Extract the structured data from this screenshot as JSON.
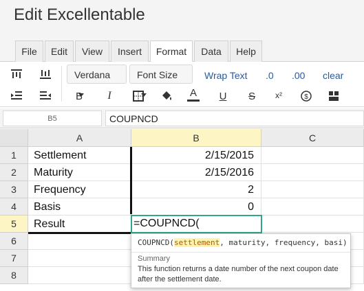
{
  "app": {
    "title": "Edit Excellentable"
  },
  "menu": {
    "tabs": [
      {
        "label": "File"
      },
      {
        "label": "Edit"
      },
      {
        "label": "View"
      },
      {
        "label": "Insert"
      },
      {
        "label": "Format",
        "active": true
      },
      {
        "label": "Data"
      },
      {
        "label": "Help"
      }
    ]
  },
  "toolbar": {
    "font_family": "Verdana",
    "font_size": "Font Size",
    "wrap_text": "Wrap Text",
    "decrease_decimal": ".0",
    "increase_decimal": ".00",
    "clear": "clear",
    "bold": "B",
    "italic": "I",
    "font_color": "A",
    "underline": "U",
    "strikethrough": "S",
    "superscript": "x²"
  },
  "formula_bar": {
    "cell_ref": "B5",
    "formula": "COUPNCD"
  },
  "sheet": {
    "columns": [
      "A",
      "B",
      "C"
    ],
    "rows": [
      {
        "num": "1",
        "a": "Settlement",
        "b": "2/15/2015"
      },
      {
        "num": "2",
        "a": "Maturity",
        "b": "2/15/2016"
      },
      {
        "num": "3",
        "a": "Frequency",
        "b": "2"
      },
      {
        "num": "4",
        "a": "Basis",
        "b": "0"
      },
      {
        "num": "5",
        "a": "Result",
        "b": ""
      },
      {
        "num": "6",
        "a": "",
        "b": ""
      },
      {
        "num": "7",
        "a": "",
        "b": ""
      },
      {
        "num": "8",
        "a": "",
        "b": ""
      }
    ],
    "active_cell_text": "=COUPNCD("
  },
  "tooltip": {
    "fn": "COUPNCD(",
    "arg_active": "settlement",
    "args_rest": ", maturity, frequency, basi)",
    "summary_label": "Summary",
    "description": "This function returns a date number of the next coupon date after the settlement date."
  },
  "colors": {
    "active_border": "#2fa58a",
    "selection_header": "#fdf6c4",
    "link_text": "#2a5a9a"
  }
}
